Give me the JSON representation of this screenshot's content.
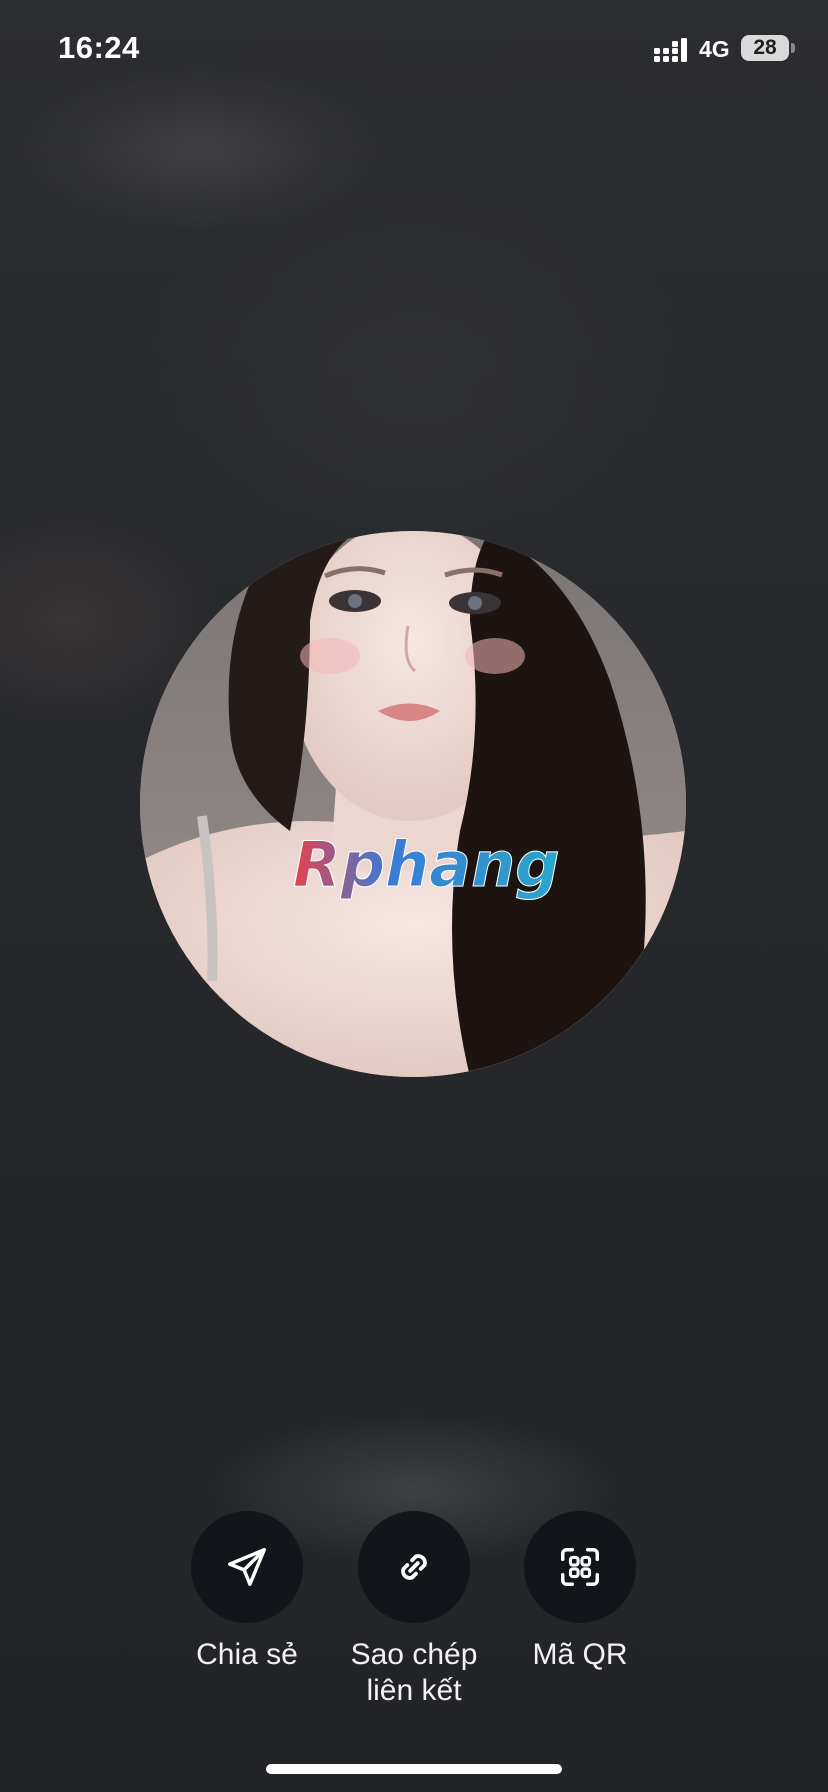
{
  "status_bar": {
    "time": "16:24",
    "network": "4G",
    "battery_level": "28",
    "signal_icon": "cellular-signal-icon"
  },
  "avatar": {
    "watermark": "Rphang",
    "watermark_colors": [
      "#e8414b",
      "#3a7bd5",
      "#2aa6c9"
    ]
  },
  "actions": [
    {
      "label": "Chia sẻ",
      "icon": "send-icon"
    },
    {
      "label": "Sao chép\nliên kết",
      "icon": "link-icon"
    },
    {
      "label": "Mã QR",
      "icon": "qr-code-icon"
    }
  ],
  "colors": {
    "background": "#25272b",
    "button_bg": "#121519",
    "text": "#f2f2f2"
  }
}
